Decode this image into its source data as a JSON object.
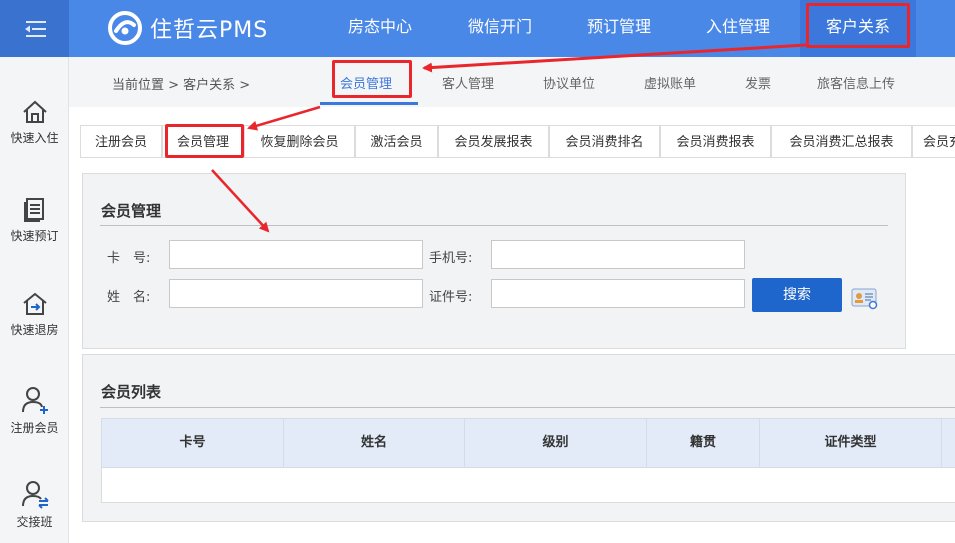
{
  "app": {
    "logo_text": "住哲云PMS"
  },
  "top_nav": [
    {
      "label": "房态中心"
    },
    {
      "label": "微信开门"
    },
    {
      "label": "预订管理"
    },
    {
      "label": "入住管理"
    },
    {
      "label": "客户关系"
    }
  ],
  "sidebar": [
    {
      "label": "快速入住",
      "icon": "home-icon"
    },
    {
      "label": "快速预订",
      "icon": "document-icon"
    },
    {
      "label": "快速退房",
      "icon": "checkout-icon"
    },
    {
      "label": "注册会员",
      "icon": "add-user-icon"
    },
    {
      "label": "交接班",
      "icon": "handover-icon"
    }
  ],
  "breadcrumb": {
    "text": "当前位置 > 客户关系 >"
  },
  "sub_tabs": [
    {
      "label": "会员管理"
    },
    {
      "label": "客人管理"
    },
    {
      "label": "协议单位"
    },
    {
      "label": "虚拟账单"
    },
    {
      "label": "发票"
    },
    {
      "label": "旅客信息上传"
    }
  ],
  "tabs": [
    {
      "label": "注册会员"
    },
    {
      "label": "会员管理"
    },
    {
      "label": "恢复删除会员"
    },
    {
      "label": "激活会员"
    },
    {
      "label": "会员发展报表"
    },
    {
      "label": "会员消费排名"
    },
    {
      "label": "会员消费报表"
    },
    {
      "label": "会员消费汇总报表"
    },
    {
      "label": "会员充"
    }
  ],
  "search_panel": {
    "title": "会员管理",
    "card_no_label": "卡　号:",
    "card_no_value": "",
    "phone_label": "手机号:",
    "phone_value": "",
    "name_label": "姓　名:",
    "name_value": "",
    "id_label": "证件号:",
    "id_value": "",
    "search_button": "搜索"
  },
  "member_list": {
    "title": "会员列表",
    "columns": [
      "卡号",
      "姓名",
      "级别",
      "籍贯",
      "证件类型"
    ]
  },
  "colors": {
    "topbar": "#4a88e8",
    "accent": "#3c78db",
    "highlight_box": "#e8262c",
    "search_button": "#1f66cc"
  }
}
